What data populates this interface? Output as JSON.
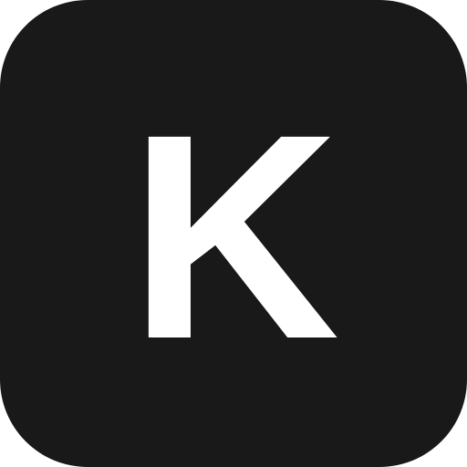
{
  "icon": {
    "letter": "K",
    "background_color": "#191919",
    "letter_color": "#ffffff"
  }
}
